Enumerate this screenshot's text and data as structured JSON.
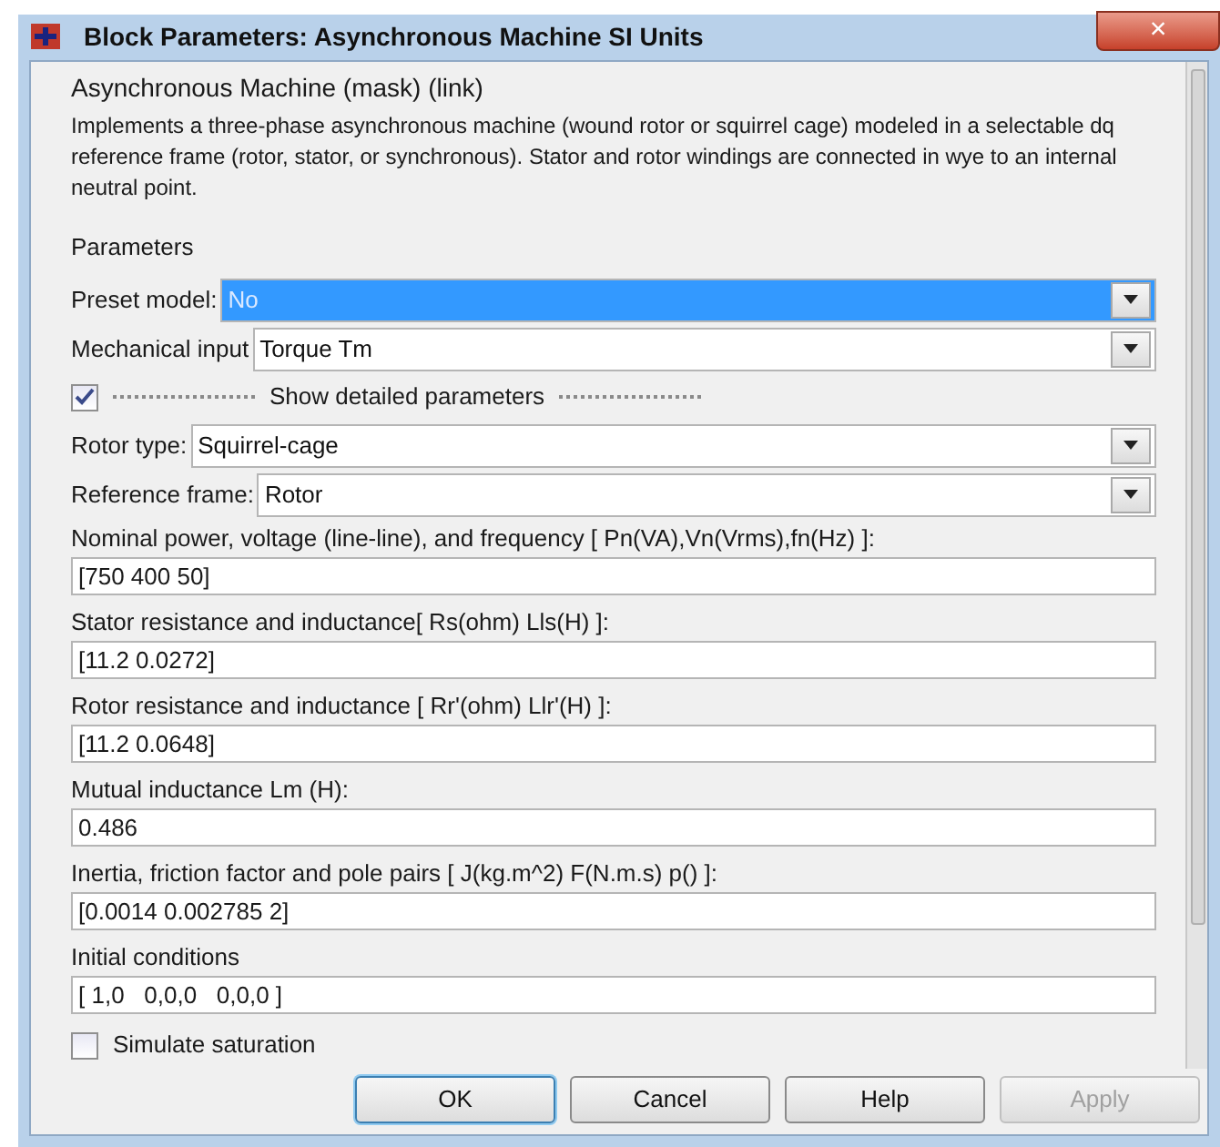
{
  "window": {
    "title": "Block Parameters: Asynchronous Machine SI Units",
    "close": "×"
  },
  "header": "Asynchronous Machine (mask) (link)",
  "description": "Implements a three-phase asynchronous machine (wound rotor or squirrel cage) modeled in a selectable  dq reference frame (rotor, stator, or synchronous). Stator and rotor windings are connected in wye to an internal neutral point.",
  "section": "Parameters",
  "params": [
    {
      "kind": "dropdown",
      "label": "Preset model:",
      "value": "No",
      "selected": true
    },
    {
      "kind": "dropdown",
      "label": "Mechanical input",
      "value": "Torque Tm",
      "selected": false
    },
    {
      "kind": "checkbox",
      "label": "Show detailed parameters",
      "checked": true,
      "dotted": true
    },
    {
      "kind": "dropdown",
      "label": "Rotor type:",
      "value": "Squirrel-cage",
      "selected": false
    },
    {
      "kind": "dropdown",
      "label": "Reference frame:",
      "value": "Rotor",
      "selected": false
    },
    {
      "kind": "text",
      "label": "Nominal power, voltage (line-line), and frequency [ Pn(VA),Vn(Vrms),fn(Hz) ]:",
      "value": "[750 400 50]"
    },
    {
      "kind": "text",
      "label": "Stator resistance and inductance[ Rs(ohm)  Lls(H) ]:",
      "value": "[11.2 0.0272]"
    },
    {
      "kind": "text",
      "label": "Rotor resistance and inductance [ Rr'(ohm)  Llr'(H) ]:",
      "value": "[11.2 0.0648]"
    },
    {
      "kind": "text",
      "label": "Mutual inductance Lm (H):",
      "value": "0.486"
    },
    {
      "kind": "text",
      "label": "Inertia, friction factor and pole pairs [ J(kg.m^2)  F(N.m.s)  p() ]:",
      "value": "[0.0014 0.002785 2]"
    },
    {
      "kind": "text",
      "label": "Initial conditions",
      "value": "[ 1,0   0,0,0   0,0,0 ]"
    },
    {
      "kind": "checkbox",
      "label": "Simulate saturation",
      "checked": false,
      "dotted": false
    }
  ],
  "buttons": [
    {
      "label": "OK",
      "default": true,
      "disabled": false
    },
    {
      "label": "Cancel",
      "default": false,
      "disabled": false
    },
    {
      "label": "Help",
      "default": false,
      "disabled": false
    },
    {
      "label": "Apply",
      "default": false,
      "disabled": true
    }
  ]
}
